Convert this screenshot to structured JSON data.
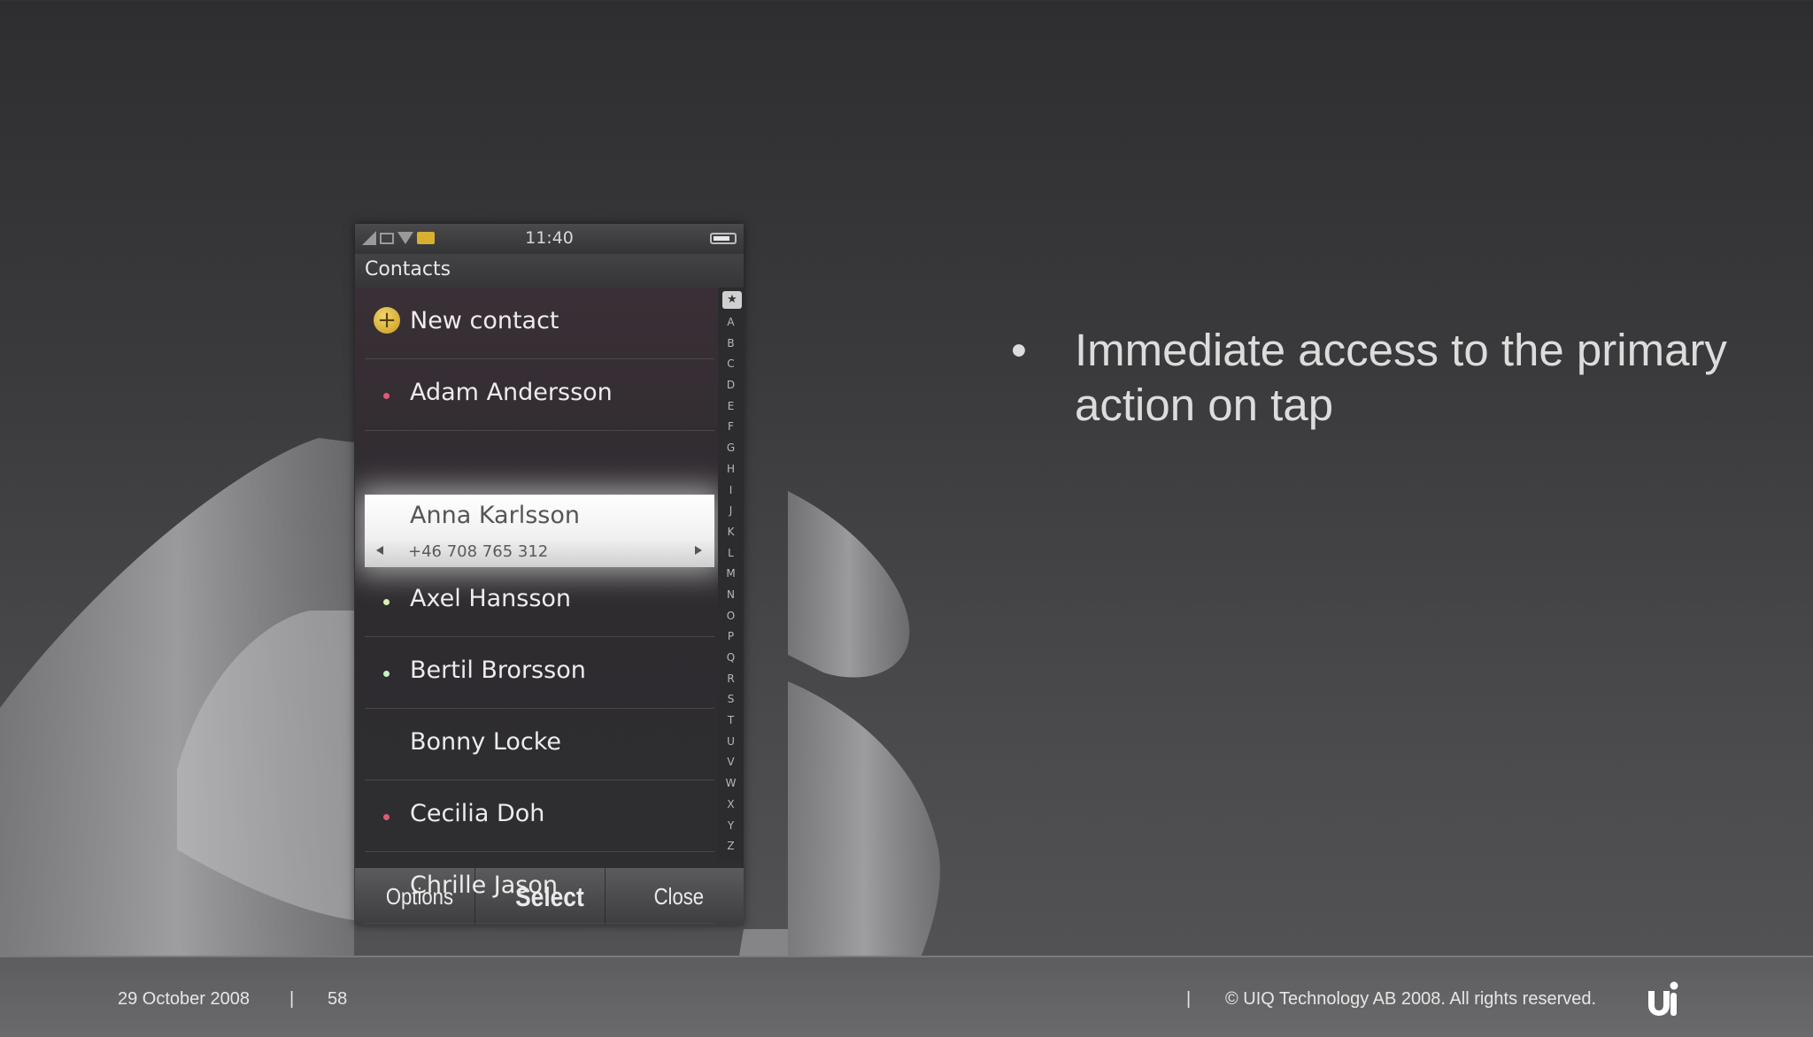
{
  "phone": {
    "status": {
      "time": "11:40"
    },
    "title": "Contacts",
    "contacts": [
      {
        "name": "New contact",
        "type": "new"
      },
      {
        "name": "Adam Andersson",
        "presence": "#e05a74"
      },
      {
        "name": "Anna Karlsson",
        "number": "+46 708 765 312",
        "selected": true
      },
      {
        "name": "Axel Hansson",
        "presence": "#d6f0b4"
      },
      {
        "name": "Bertil Brorsson",
        "presence": "#c8f0c8"
      },
      {
        "name": "Bonny Locke"
      },
      {
        "name": "Cecilia Doh",
        "presence": "#e05a74"
      },
      {
        "name": "Chrille Jason"
      }
    ],
    "index_letters": [
      "A",
      "B",
      "C",
      "D",
      "E",
      "F",
      "G",
      "H",
      "I",
      "J",
      "K",
      "L",
      "M",
      "N",
      "O",
      "P",
      "Q",
      "R",
      "S",
      "T",
      "U",
      "V",
      "W",
      "X",
      "Y",
      "Z"
    ],
    "softkeys": {
      "left": "Options",
      "center": "Select",
      "right": "Close"
    }
  },
  "slide": {
    "bullet": "•",
    "bullet_text": "Immediate access to the primary action on tap"
  },
  "footer": {
    "date": "29 October 2008",
    "separator": "|",
    "page_number": "58",
    "copyright": "© UIQ Technology AB 2008. All rights reserved."
  }
}
